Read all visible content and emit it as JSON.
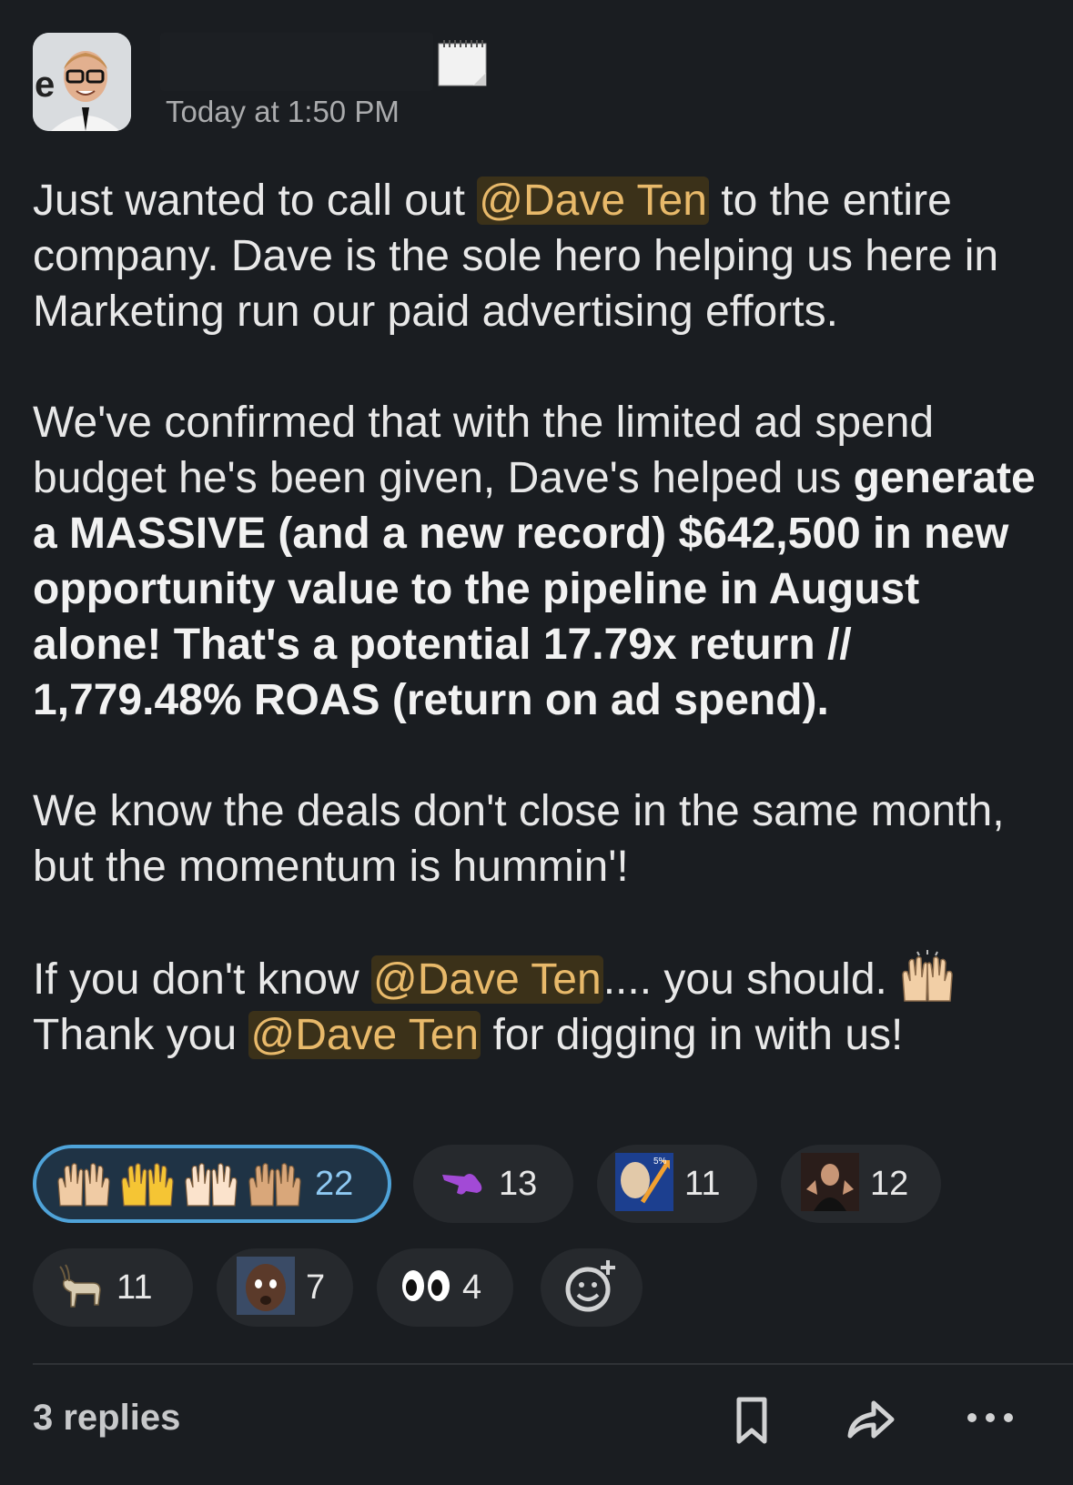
{
  "message": {
    "timestamp": "Today at 1:50 PM",
    "p1_a": "Just wanted to call out ",
    "mention": "@Dave Ten",
    "p1_b": " to the entire company. Dave is the sole hero helping us here in Marketing run our paid advertising efforts.",
    "p2_a": "We've confirmed that with the limited ad spend budget he's been given, Dave's helped us ",
    "p2_bold": "generate a MASSIVE (and a new record) $642,500 in new opportunity value to the pipeline in August alone! That's a potential 17.79x return // 1,779.48% ROAS (return on ad spend).",
    "p3": "We know the deals don't close in the same month, but the momentum is hummin'!",
    "p4_a": "If you don't know ",
    "p4_b": ".... you should.",
    "p5_a": "Thank you ",
    "p5_b": " for digging in with us!"
  },
  "reactions": [
    {
      "icon": "raising-hands-icon",
      "count": "22",
      "active": true
    },
    {
      "icon": "pointing-hand-icon",
      "count": "13"
    },
    {
      "icon": "stonks-meme-icon",
      "count": "11"
    },
    {
      "icon": "person-photo-icon",
      "count": "12"
    },
    {
      "icon": "goat-icon",
      "count": "11"
    },
    {
      "icon": "shaq-face-icon",
      "count": "7"
    },
    {
      "icon": "eyes-icon",
      "count": "4"
    }
  ],
  "footer": {
    "replies": "3 replies"
  },
  "colors": {
    "background": "#1a1d21",
    "mention_bg": "#3b3119",
    "mention_text": "#e8b96a",
    "active_border": "#4fa3d9"
  }
}
